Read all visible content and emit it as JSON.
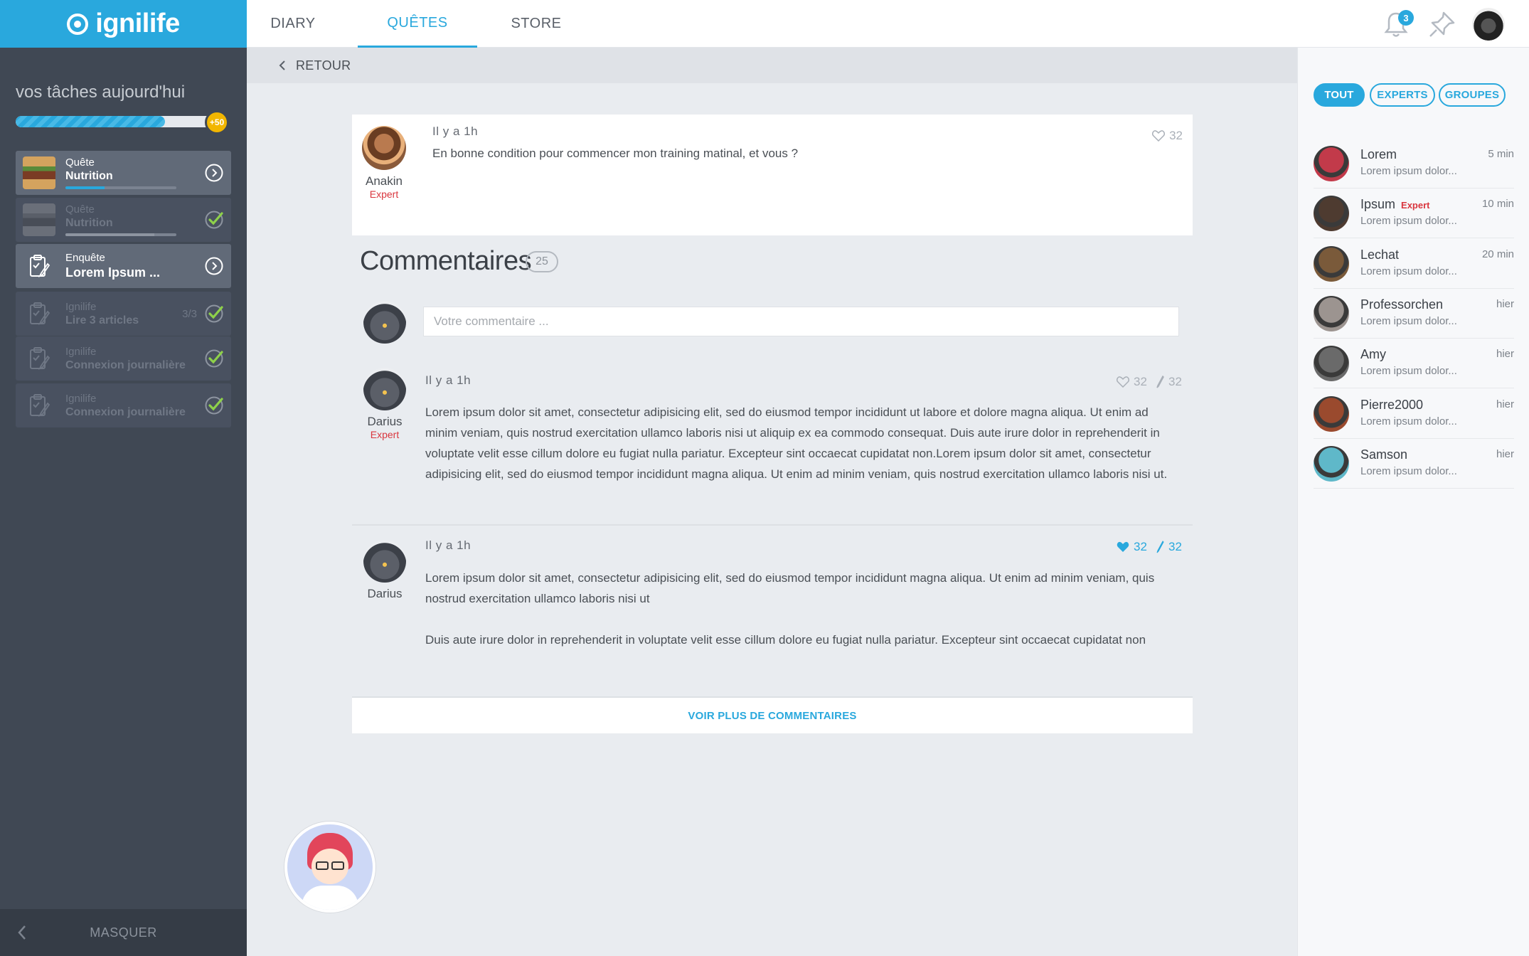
{
  "app": {
    "logo_text": "ignilife",
    "accent": "#29a8dd"
  },
  "nav": {
    "tabs": [
      {
        "label": "DIARY"
      },
      {
        "label": "QUÊTES",
        "active": true
      },
      {
        "label": "STORE"
      }
    ]
  },
  "header": {
    "notification_count": "3"
  },
  "sidebar": {
    "tasks_title": "vos tâches aujourd'hui",
    "progress_fraction": 0.75,
    "bonus": "+50",
    "tasks": [
      {
        "line1": "Quête",
        "line2": "Nutrition",
        "state": "active",
        "progress": 0.35,
        "icon": "food-thumbnail",
        "action": "arrow-right-circle-icon"
      },
      {
        "line1": "Quête",
        "line2": "Nutrition",
        "state": "done",
        "progress": 0.8,
        "icon": "food-thumbnail",
        "action": "check-icon"
      },
      {
        "line1": "Enquête",
        "line2": "Lorem Ipsum ...",
        "state": "active",
        "icon": "clipboard-icon",
        "action": "arrow-right-circle-icon"
      },
      {
        "line1": "Ignilife",
        "line2": "Lire 3 articles",
        "count": "3/3",
        "state": "done",
        "icon": "clipboard-icon",
        "action": "check-icon"
      },
      {
        "line1": "Ignilife",
        "line2": "Connexion journalière",
        "state": "done",
        "icon": "clipboard-icon",
        "action": "check-icon"
      },
      {
        "line1": "Ignilife",
        "line2": "Connexion journalière",
        "state": "done",
        "icon": "clipboard-icon",
        "action": "check-icon"
      }
    ],
    "hide_label": "MASQUER"
  },
  "backbar": {
    "label": "RETOUR"
  },
  "post": {
    "author": "Anakin",
    "badge": "Expert",
    "time": "Il y a 1h",
    "text": "En bonne condition pour commencer mon training matinal, et vous ?",
    "likes": "32"
  },
  "comments": {
    "title": "Commentaires",
    "count": "25",
    "input_placeholder": "Votre commentaire ...",
    "items": [
      {
        "author": "Darius",
        "badge": "Expert",
        "time": "Il y a 1h",
        "likes": "32",
        "replies": "32",
        "liked": false,
        "paragraphs": [
          "Lorem ipsum dolor sit amet, consectetur adipisicing elit, sed do eiusmod tempor incididunt ut labore et dolore magna aliqua. Ut enim ad minim veniam, quis nostrud exercitation ullamco laboris nisi ut aliquip ex ea commodo consequat. Duis aute irure dolor in reprehenderit in voluptate velit esse cillum dolore eu fugiat nulla pariatur. Excepteur sint occaecat cupidatat non.Lorem ipsum dolor sit amet, consectetur adipisicing elit, sed do eiusmod tempor incididunt  magna aliqua. Ut enim ad minim veniam, quis nostrud exercitation ullamco laboris nisi ut."
        ]
      },
      {
        "author": "Darius",
        "badge": "",
        "time": "Il y a 1h",
        "likes": "32",
        "replies": "32",
        "liked": true,
        "paragraphs": [
          "Lorem ipsum dolor sit amet, consectetur adipisicing elit, sed do eiusmod tempor incididunt  magna aliqua. Ut enim ad minim veniam, quis nostrud exercitation ullamco laboris nisi ut",
          "Duis aute irure dolor in reprehenderit in voluptate velit esse cillum dolore eu fugiat nulla pariatur. Excepteur sint occaecat cupidatat non"
        ]
      }
    ],
    "more_label": "VOIR PLUS DE COMMENTAIRES"
  },
  "right_panel": {
    "filters": [
      {
        "label": "TOUT",
        "active": true
      },
      {
        "label": "EXPERTS"
      },
      {
        "label": "GROUPES"
      }
    ],
    "contacts": [
      {
        "name": "Lorem",
        "badge": "",
        "time": "5 min",
        "message": "Lorem ipsum dolor...",
        "avatar_color": "#c23a4a"
      },
      {
        "name": "Ipsum",
        "badge": "Expert",
        "time": "10 min",
        "message": "Lorem ipsum dolor...",
        "avatar_color": "#4e3b30"
      },
      {
        "name": "Lechat",
        "badge": "",
        "time": "20 min",
        "message": "Lorem ipsum dolor...",
        "avatar_color": "#7a5a3a"
      },
      {
        "name": "Professorchen",
        "badge": "",
        "time": "hier",
        "message": "Lorem ipsum dolor...",
        "avatar_color": "#9c9490"
      },
      {
        "name": "Amy",
        "badge": "",
        "time": "hier",
        "message": "Lorem ipsum dolor...",
        "avatar_color": "#6a6a6a"
      },
      {
        "name": "Pierre2000",
        "badge": "",
        "time": "hier",
        "message": "Lorem ipsum dolor...",
        "avatar_color": "#9a4a2e"
      },
      {
        "name": "Samson",
        "badge": "",
        "time": "hier",
        "message": "Lorem ipsum dolor...",
        "avatar_color": "#5fb8c9"
      }
    ]
  }
}
